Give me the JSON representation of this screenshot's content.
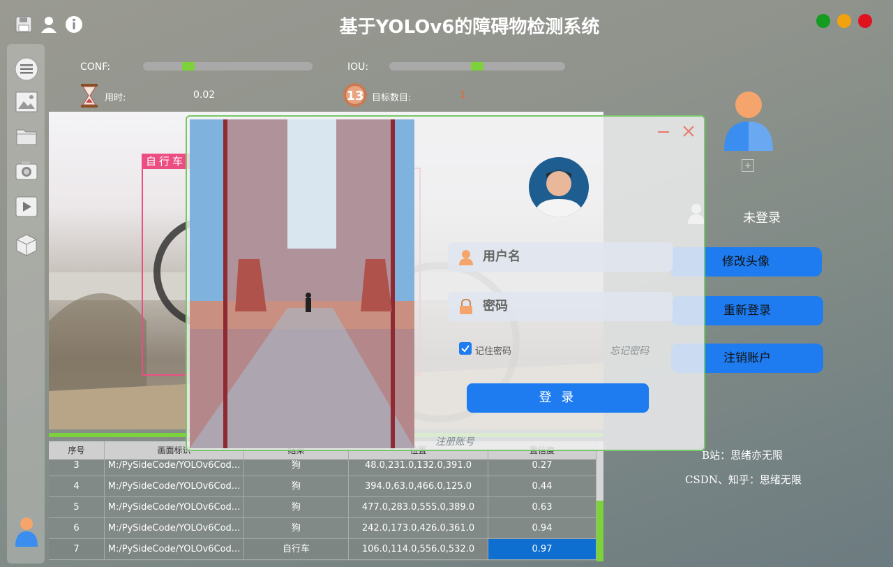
{
  "app": {
    "title": "基于YOLOv6的障碍物检测系统",
    "window_controls": {
      "colors": [
        "#139c1f",
        "#f2a20f",
        "#e0121e"
      ]
    }
  },
  "toolbar_icons": [
    "save-icon",
    "user-icon",
    "info-icon"
  ],
  "sidebar_icons": [
    "menu-icon",
    "image-icon",
    "folder-icon",
    "camera-icon",
    "video-icon",
    "model-cube-icon",
    "user-avatar-icon"
  ],
  "controls": {
    "conf_label": "CONF:",
    "conf_value": 0.25,
    "iou_label": "IOU:",
    "iou_value": 0.5,
    "time_label": "用时:",
    "time_value": "0.02",
    "count_label": "目标数目:",
    "count_value": "1"
  },
  "detection": {
    "label": "自行车",
    "color": "#ec4e82"
  },
  "table": {
    "headers": [
      "序号",
      "画面标识",
      "结果",
      "位置",
      "置信度"
    ],
    "rows": [
      {
        "idx": "3",
        "path": "M:/PySideCode/YOLOv6Cod...",
        "result": "狗",
        "pos": "48.0,231.0,132.0,391.0",
        "conf": "0.27"
      },
      {
        "idx": "4",
        "path": "M:/PySideCode/YOLOv6Cod...",
        "result": "狗",
        "pos": "394.0,63.0,466.0,125.0",
        "conf": "0.44"
      },
      {
        "idx": "5",
        "path": "M:/PySideCode/YOLOv6Cod...",
        "result": "狗",
        "pos": "477.0,283.0,555.0,389.0",
        "conf": "0.63"
      },
      {
        "idx": "6",
        "path": "M:/PySideCode/YOLOv6Cod...",
        "result": "狗",
        "pos": "242.0,173.0,426.0,361.0",
        "conf": "0.94"
      },
      {
        "idx": "7",
        "path": "M:/PySideCode/YOLOv6Cod...",
        "result": "自行车",
        "pos": "106.0,114.0,556.0,532.0",
        "conf": "0.97"
      }
    ]
  },
  "right_panel": {
    "status": "未登录",
    "buttons": [
      "修改头像",
      "重新登录",
      "注销账户"
    ],
    "credit1": "B站：思绪亦无限",
    "credit2": "CSDN、知乎：思绪无限"
  },
  "login": {
    "username_placeholder": "用户名",
    "password_placeholder": "密码",
    "remember_label": "记住密码",
    "remember_checked": true,
    "forgot_label": "忘记密码",
    "login_button": "登 录",
    "register_link": "注册账号"
  }
}
